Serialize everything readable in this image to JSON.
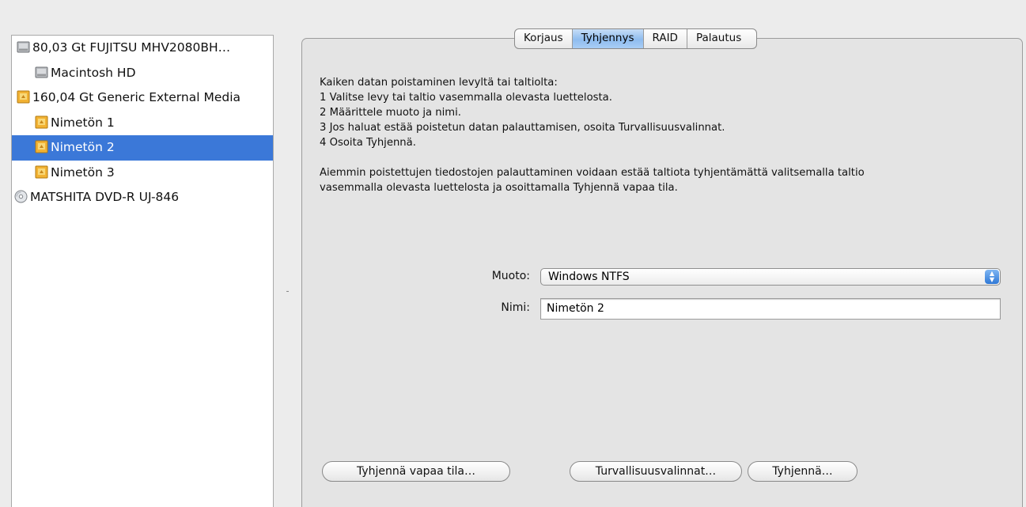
{
  "sidebar": {
    "items": [
      {
        "label": "80,03 Gt FUJITSU MHV2080BH…",
        "icon": "hard-disk-icon",
        "level": 0,
        "selected": false
      },
      {
        "label": "Macintosh HD",
        "icon": "volume-icon",
        "level": 1,
        "selected": false
      },
      {
        "label": "160,04 Gt Generic External Media",
        "icon": "external-disk-icon",
        "level": 0,
        "selected": false
      },
      {
        "label": "Nimetön 1",
        "icon": "external-volume-icon",
        "level": 1,
        "selected": false
      },
      {
        "label": "Nimetön 2",
        "icon": "external-volume-icon",
        "level": 1,
        "selected": true
      },
      {
        "label": "Nimetön 3",
        "icon": "external-volume-icon",
        "level": 1,
        "selected": false
      },
      {
        "label": "MATSHITA DVD-R UJ-846",
        "icon": "optical-drive-icon",
        "level": 0,
        "selected": false
      }
    ]
  },
  "tabs": [
    {
      "label": "Korjaus",
      "active": false
    },
    {
      "label": "Tyhjennys",
      "active": true
    },
    {
      "label": "RAID",
      "active": false
    },
    {
      "label": "Palautus",
      "active": false
    }
  ],
  "instructions": {
    "heading": "Kaiken datan poistaminen levyltä tai taltiolta:",
    "steps": [
      "1 Valitse levy tai taltio vasemmalla olevasta luettelosta.",
      "2 Määrittele muoto ja nimi.",
      "3 Jos haluat estää poistetun datan palauttamisen, osoita Turvallisuusvalinnat.",
      "4 Osoita Tyhjennä."
    ],
    "free_space_line1": "Aiemmin poistettujen tiedostojen palauttaminen voidaan estää taltiota tyhjentämättä valitsemalla taltio",
    "free_space_line2": "vasemmalla olevasta luettelosta ja osoittamalla Tyhjennä vapaa tila."
  },
  "form": {
    "format_label": "Muoto:",
    "format_value": "Windows NTFS",
    "name_label": "Nimi:",
    "name_value": "Nimetön 2"
  },
  "buttons": {
    "erase_free_space": "Tyhjennä vapaa tila…",
    "security_options": "Turvallisuusvalinnat…",
    "erase": "Tyhjennä…"
  },
  "colors": {
    "selection": "#3b78d8",
    "active_tab": "#8fbcef"
  }
}
